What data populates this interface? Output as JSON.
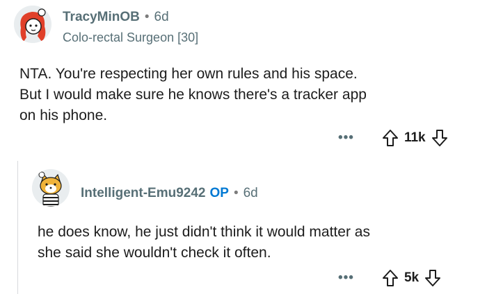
{
  "comment": {
    "username": "TracyMinOB",
    "age": "6d",
    "flair": "Colo-rectal Surgeon [30]",
    "body_lines": [
      "NTA. You're respecting her own rules and his space.",
      "But I would make sure he knows there's a tracker app",
      "on his phone."
    ],
    "more": "•••",
    "score": "11k",
    "upvote_icon": "arrow-up-outline-icon",
    "downvote_icon": "arrow-down-outline-icon"
  },
  "reply": {
    "username": "Intelligent-Emu9242",
    "op_badge": "OP",
    "age": "6d",
    "body_lines": [
      "he does know, he just didn't think it would matter as",
      "she said she wouldn't check it often."
    ],
    "more": "•••",
    "score": "5k",
    "upvote_icon": "arrow-up-outline-icon",
    "downvote_icon": "arrow-down-outline-icon"
  },
  "colors": {
    "username": "#576f76",
    "op": "#0079d3",
    "text": "#1c1c1c",
    "thread_line": "#d7dadc"
  }
}
